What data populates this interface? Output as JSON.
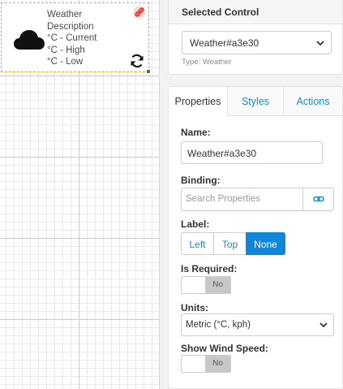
{
  "widget": {
    "lines": [
      "Weather",
      "Description",
      "°C - Current",
      "°C - High",
      "°C - Low"
    ],
    "icons": {
      "weather": "cloud-icon",
      "unlink": "unlink-icon",
      "refresh": "refresh-icon"
    }
  },
  "selected_control": {
    "heading": "Selected Control",
    "value": "Weather#a3e30",
    "type_label": "Type: Weather"
  },
  "tabs": [
    {
      "label": "Properties",
      "active": true
    },
    {
      "label": "Styles",
      "active": false
    },
    {
      "label": "Actions",
      "active": false
    }
  ],
  "properties": {
    "name_label": "Name:",
    "name_value": "Weather#a3e30",
    "binding_label": "Binding:",
    "binding_placeholder": "Search Properties",
    "label_label": "Label:",
    "label_options": [
      "Left",
      "Top",
      "None"
    ],
    "label_selected": "None",
    "required_label": "Is Required:",
    "required_value": "No",
    "units_label": "Units:",
    "units_value": "Metric (°C, kph)",
    "wind_label": "Show Wind Speed:",
    "wind_value": "No"
  },
  "colors": {
    "accent": "#0f87d8",
    "link": "#1a8acd",
    "selection_border": "#f0a336",
    "unlink_icon": "#e0443e"
  }
}
